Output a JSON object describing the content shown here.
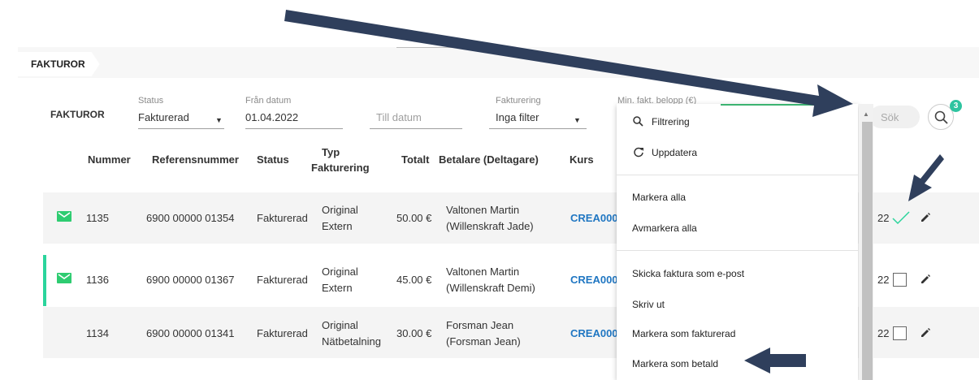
{
  "tab": {
    "label": "FAKTUROR"
  },
  "filters": {
    "title": "FAKTUROR",
    "status_label": "Status",
    "status_value": "Fakturerad",
    "from_label": "Från datum",
    "from_value": "01.04.2022",
    "to_placeholder": "Till datum",
    "billing_label": "Fakturering",
    "billing_value": "Inga filter",
    "min_amount_label": "Min. fakt. belopp (€)",
    "search_placeholder": "Sök",
    "search_badge": "3"
  },
  "table": {
    "headers": {
      "number": "Nummer",
      "reference": "Referensnummer",
      "status": "Status",
      "type_line1": "Typ",
      "type_line2": "Fakturering",
      "total": "Totalt",
      "payer": "Betalare (Deltagare)",
      "course": "Kurs"
    },
    "rows": [
      {
        "number": "1135",
        "reference": "6900 00000 01354",
        "status": "Fakturerad",
        "type1": "Original",
        "type2": "Extern",
        "total": "50.00 €",
        "payer1": "Valtonen Martin",
        "payer2": "(Willenskraft Jade)",
        "course": "CREA000",
        "trail": "22"
      },
      {
        "number": "1136",
        "reference": "6900 00000 01367",
        "status": "Fakturerad",
        "type1": "Original",
        "type2": "Extern",
        "total": "45.00 €",
        "payer1": "Valtonen Martin",
        "payer2": "(Willenskraft Demi)",
        "course": "CREA000",
        "trail": "22"
      },
      {
        "number": "1134",
        "reference": "6900 00000 01341",
        "status": "Fakturerad",
        "type1": "Original",
        "type2": "Nätbetalning",
        "total": "30.00 €",
        "payer1": "Forsman Jean",
        "payer2": "(Forsman Jean)",
        "course": "CREA000",
        "trail": "22"
      }
    ]
  },
  "menu": {
    "filter": "Filtrering",
    "refresh": "Uppdatera",
    "select_all": "Markera alla",
    "deselect_all": "Avmarkera alla",
    "send_email": "Skicka faktura som e-post",
    "print": "Skriv ut",
    "mark_invoiced": "Markera som fakturerad",
    "mark_paid": "Markera som betald"
  },
  "colors": {
    "accent": "#2bd49c",
    "link": "#1f76c2",
    "mail_icon": "#2ecc71",
    "arrow": "#2f3f5c"
  }
}
